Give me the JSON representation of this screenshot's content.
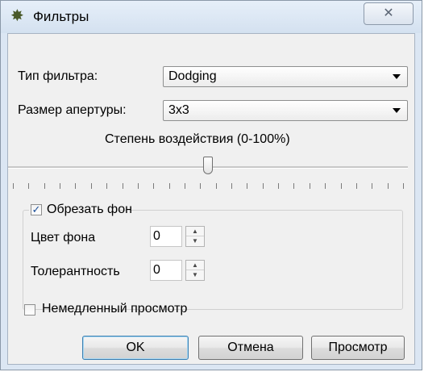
{
  "window": {
    "title": "Фильтры",
    "close_glyph": "✕"
  },
  "filter_type": {
    "label": "Тип фильтра:",
    "value": "Dodging"
  },
  "aperture": {
    "label": "Размер апертуры:",
    "value": "3x3"
  },
  "intensity": {
    "label": "Степень воздействия (0-100%)",
    "level_fraction": 0.5
  },
  "crop_background": {
    "label": "Обрезать фон",
    "checked": true,
    "bg_color": {
      "label": "Цвет фона",
      "value": "0"
    },
    "tolerance": {
      "label": "Толерантность",
      "value": "0"
    }
  },
  "instant_preview": {
    "label": "Немедленный просмотр",
    "checked": false
  },
  "buttons": {
    "ok": "OK",
    "cancel": "Отмена",
    "preview": "Просмотр"
  },
  "icons": {
    "app": "gear-icon",
    "close": "close-icon",
    "spin_up": "up-arrow-icon",
    "spin_down": "down-arrow-icon"
  }
}
